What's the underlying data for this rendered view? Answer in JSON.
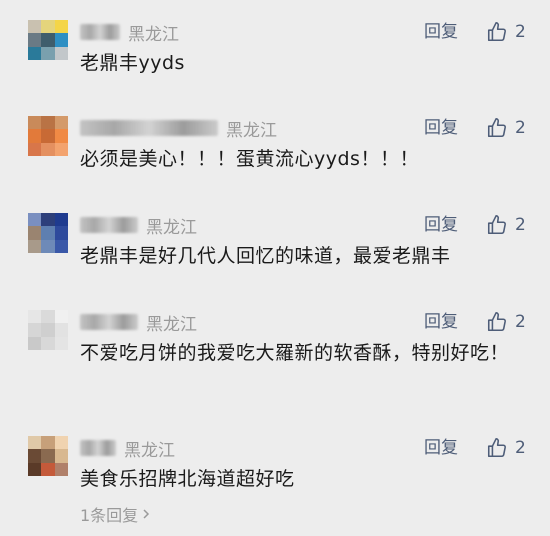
{
  "comments": [
    {
      "location": "黑龙江",
      "reply_label": "回复",
      "likes": "2",
      "text": "老鼎丰yyds",
      "avatar_colors": [
        "#c9c1b0",
        "#e4d47c",
        "#f4d548",
        "#6a7a85",
        "#3f5d6c",
        "#2e8fc3",
        "#2a7a9a",
        "#7aa0ae",
        "#c2c7ca"
      ]
    },
    {
      "location": "黑龙江",
      "reply_label": "回复",
      "likes": "2",
      "text": "必须是美心！！！蛋黄流心yyds！！！",
      "avatar_colors": [
        "#c98a5a",
        "#b97345",
        "#d49a6a",
        "#e27a3a",
        "#c86a35",
        "#f08a45",
        "#d8764a",
        "#e49060",
        "#f3a36e"
      ]
    },
    {
      "location": "黑龙江",
      "reply_label": "回复",
      "likes": "2",
      "text": "老鼎丰是好几代人回忆的味道，最爱老鼎丰",
      "avatar_colors": [
        "#7a8fc0",
        "#2d3f7a",
        "#1f3b8f",
        "#9a8470",
        "#5e7fb0",
        "#2e4a9c",
        "#a89a8a",
        "#6e8ab8",
        "#3a58a8"
      ]
    },
    {
      "location": "黑龙江",
      "reply_label": "回复",
      "likes": "2",
      "text": "不爱吃月饼的我爱吃大羅新的软香酥，特别好吃！",
      "avatar_colors": [
        "#e6e6e6",
        "#dadada",
        "#f0f0f0",
        "#d6d6d6",
        "#cfcfcf",
        "#e2e2e2",
        "#c9c9c9",
        "#d8d8d8",
        "#e4e4e4"
      ]
    },
    {
      "location": "黑龙江",
      "reply_label": "回复",
      "likes": "2",
      "text": "美食乐招牌北海道超好吃",
      "avatar_colors": [
        "#e0c9a8",
        "#c7a07a",
        "#f0d3b0",
        "#6a4a35",
        "#8a6a50",
        "#d8b890",
        "#5a3a28",
        "#c45a3a",
        "#b0806a"
      ]
    }
  ],
  "more_replies": "1条回复",
  "colors": {
    "background": "#ededed",
    "meta_text": "#9a9a9a",
    "action_text": "#4e5d78",
    "body_text": "#1a1a1a"
  },
  "icons": {
    "like": "thumbs-up-icon",
    "more": "chevron-right-icon"
  }
}
